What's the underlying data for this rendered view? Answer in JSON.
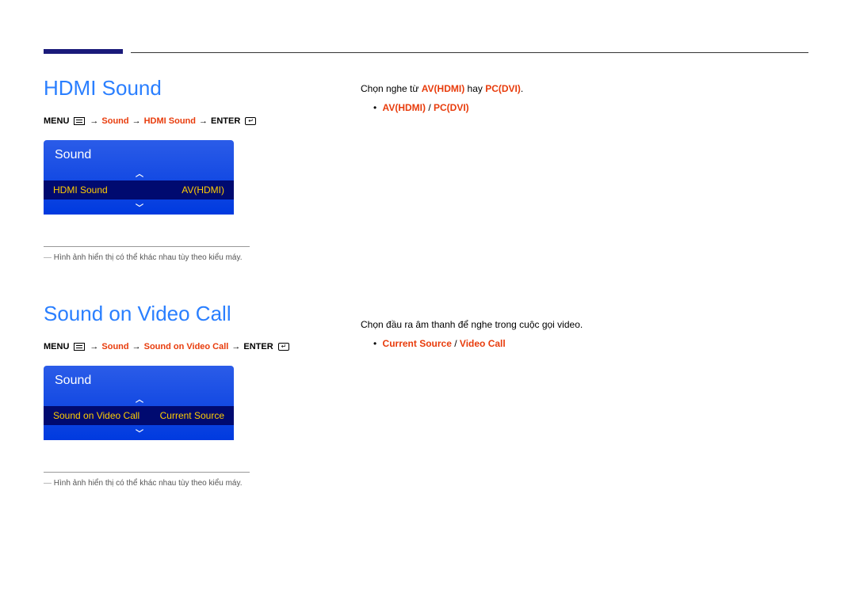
{
  "section1": {
    "title": "HDMI Sound",
    "breadcrumb": {
      "menu": "MENU",
      "path1": "Sound",
      "path2": "HDMI Sound",
      "enter": "ENTER"
    },
    "box": {
      "title": "Sound",
      "sel_left": "HDMI Sound",
      "sel_right": "AV(HDMI)"
    },
    "note": "Hình ảnh hiển thị có thể khác nhau tùy theo kiểu máy.",
    "desc_pre": "Chọn nghe từ ",
    "desc_a": "AV(HDMI)",
    "desc_mid": " hay ",
    "desc_b": "PC(DVI)",
    "desc_post": ".",
    "bullet_a": "AV(HDMI)",
    "bullet_sep": " / ",
    "bullet_b": "PC(DVI)"
  },
  "section2": {
    "title": "Sound on Video Call",
    "breadcrumb": {
      "menu": "MENU",
      "path1": "Sound",
      "path2": "Sound on Video Call",
      "enter": "ENTER"
    },
    "box": {
      "title": "Sound",
      "sel_left": "Sound on Video Call",
      "sel_right": "Current Source"
    },
    "note": "Hình ảnh hiển thị có thể khác nhau tùy theo kiểu máy.",
    "desc": "Chọn đầu ra âm thanh để nghe trong cuộc gọi video.",
    "bullet_a": "Current Source",
    "bullet_sep": " / ",
    "bullet_b": "Video Call"
  }
}
